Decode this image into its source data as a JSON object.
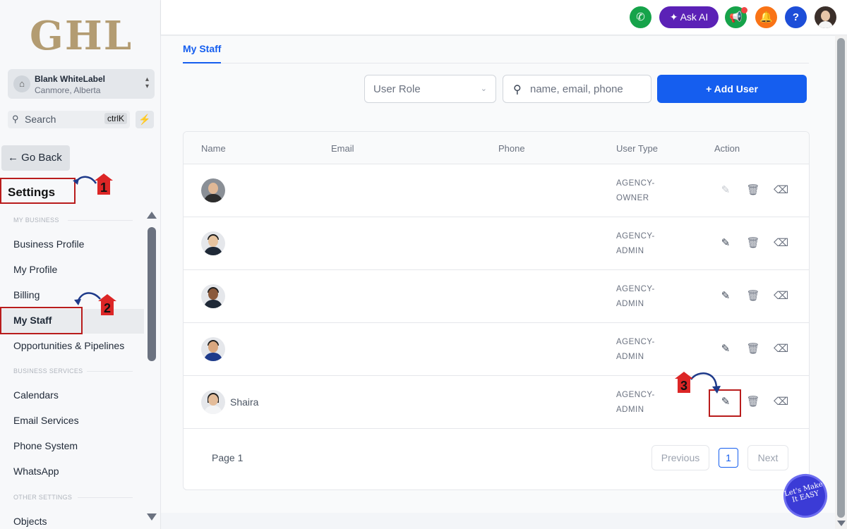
{
  "sidebar": {
    "logo": "GHL",
    "account_name": "Blank WhiteLabel",
    "account_location": "Canmore, Alberta",
    "search_label": "Search",
    "search_shortcut": "ctrlK",
    "go_back": "Go Back",
    "settings_title": "Settings",
    "sections": [
      {
        "label": "MY BUSINESS",
        "items": [
          "Business Profile",
          "My Profile",
          "Billing",
          "My Staff",
          "Opportunities & Pipelines"
        ]
      },
      {
        "label": "BUSINESS SERVICES",
        "items": [
          "Calendars",
          "Email Services",
          "Phone System",
          "WhatsApp"
        ]
      },
      {
        "label": "OTHER SETTINGS",
        "items": [
          "Objects"
        ]
      }
    ],
    "active_item": "My Staff"
  },
  "topbar": {
    "ask_ai": "Ask AI",
    "help": "?"
  },
  "main": {
    "tab": "My Staff",
    "role_filter_placeholder": "User Role",
    "search_placeholder": "name, email, phone",
    "add_user": "+ Add User",
    "table": {
      "headers": [
        "Name",
        "Email",
        "Phone",
        "User Type",
        "Action"
      ],
      "rows": [
        {
          "name": "",
          "type_line1": "AGENCY-",
          "type_line2": "OWNER",
          "edit_enabled": false
        },
        {
          "name": "",
          "type_line1": "AGENCY-",
          "type_line2": "ADMIN",
          "edit_enabled": true
        },
        {
          "name": "",
          "type_line1": "AGENCY-",
          "type_line2": "ADMIN",
          "edit_enabled": true
        },
        {
          "name": "",
          "type_line1": "AGENCY-",
          "type_line2": "ADMIN",
          "edit_enabled": true
        },
        {
          "name": "Shaira",
          "type_line1": "AGENCY-",
          "type_line2": "ADMIN",
          "edit_enabled": true
        }
      ]
    },
    "pagination": {
      "page_label": "Page 1",
      "previous": "Previous",
      "current": "1",
      "next": "Next"
    }
  },
  "annotations": {
    "step1": "1",
    "step2": "2",
    "step3": "3",
    "badge": "Let's Make It EASY"
  },
  "colors": {
    "primary": "#155eef",
    "annotation_red": "#dc2626",
    "ask_ai_bg": "#5b21b6"
  }
}
